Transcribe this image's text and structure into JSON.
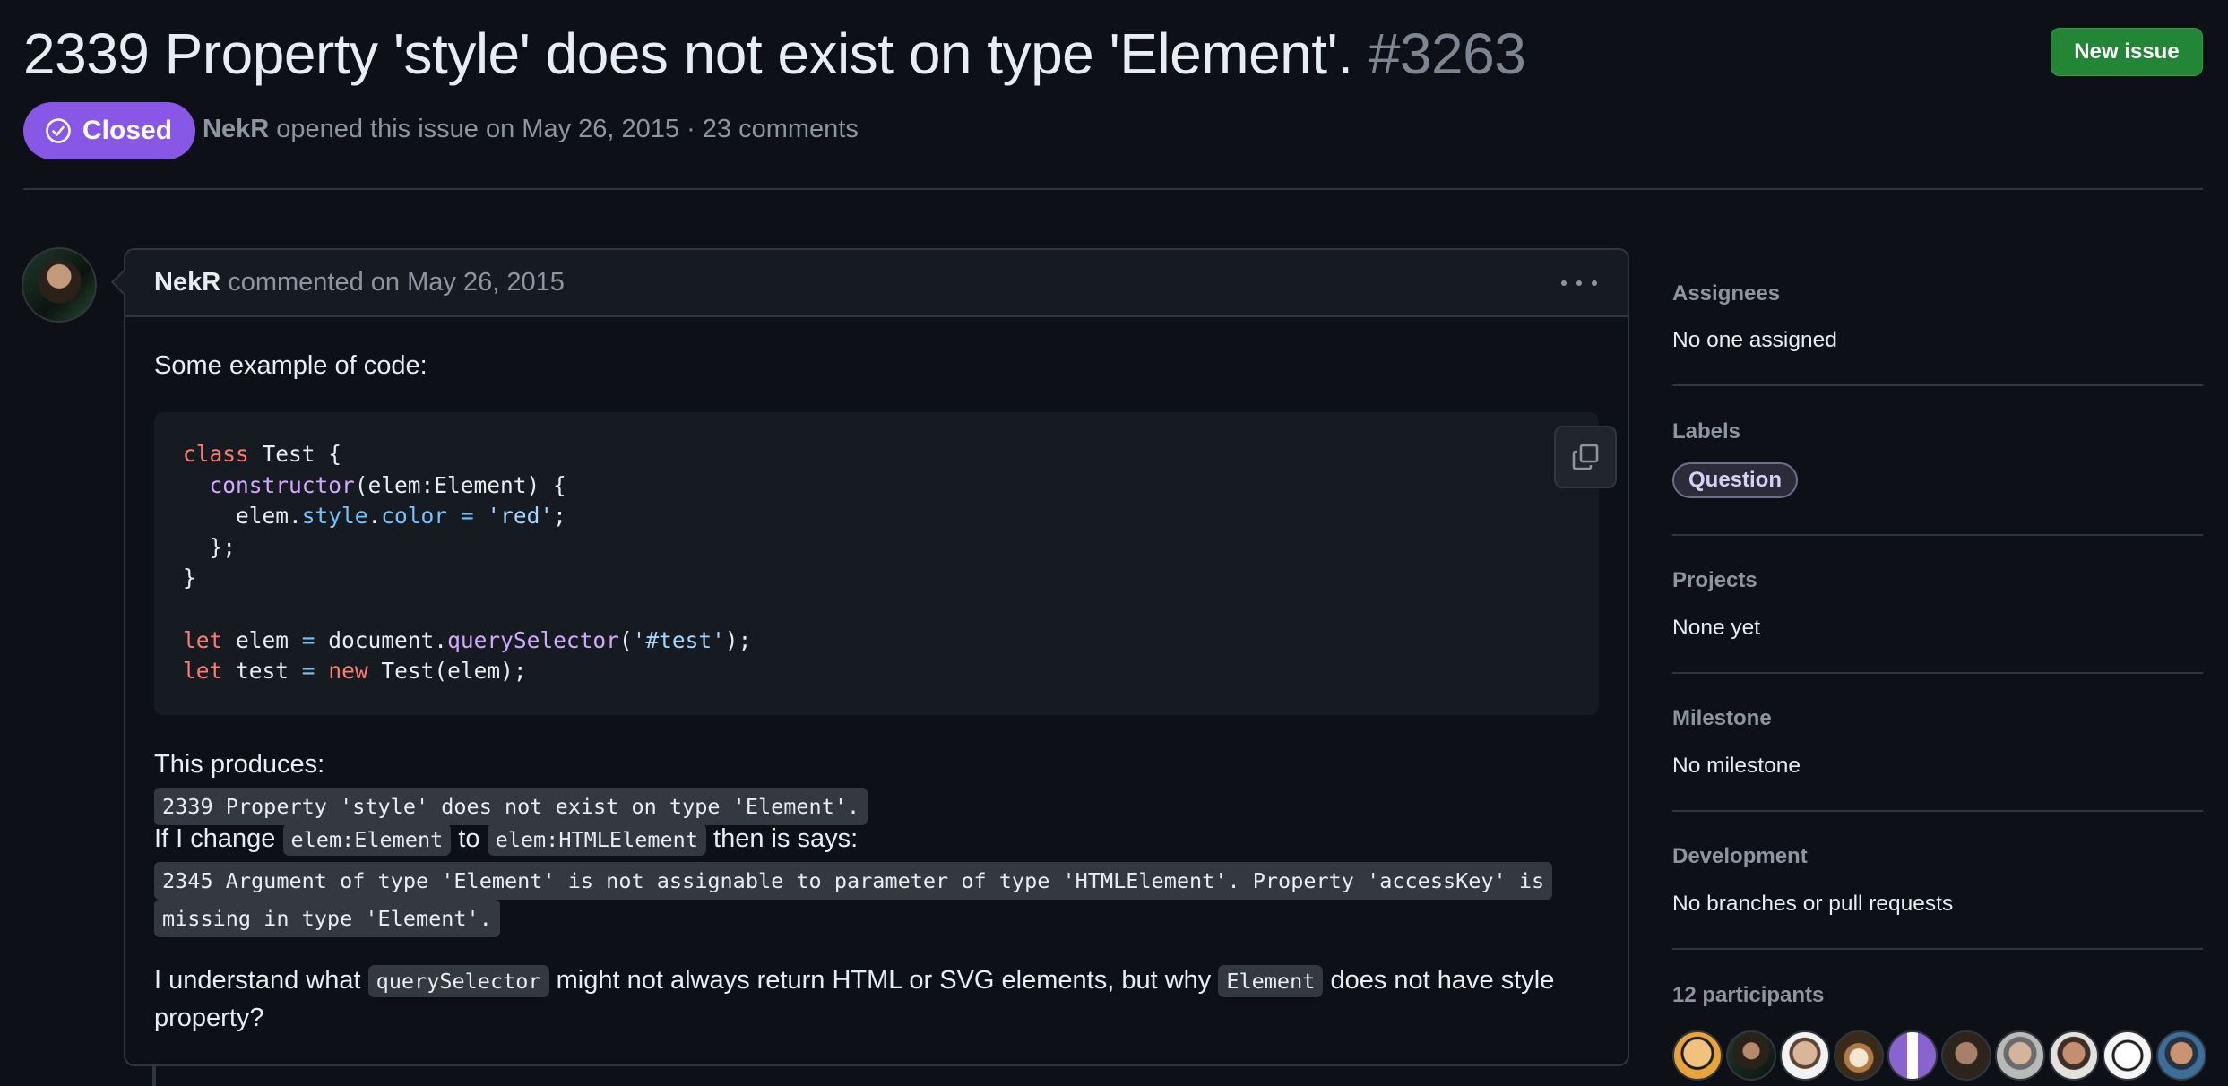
{
  "issue": {
    "title": "2339 Property 'style' does not exist on type 'Element'.",
    "number": "#3263",
    "state": "Closed",
    "author": "NekR",
    "opened_text": "opened this issue on May 26, 2015 · 23 comments"
  },
  "header": {
    "new_issue_label": "New issue"
  },
  "comment": {
    "author": "NekR",
    "meta": "commented on May 26, 2015",
    "intro": "Some example of code:",
    "produces_label": "This produces:",
    "error1": "2339 Property 'style' does not exist on type 'Element'.",
    "change_pre": "If I change",
    "change_from": "elem:Element",
    "change_to_word": "to",
    "change_to": "elem:HTMLElement",
    "change_post": "then is says:",
    "error2_line1": "2345 Argument of type 'Element' is not assignable to parameter of type 'HTMLElement'. Property 'accessKey' is",
    "error2_line2": "missing in type 'Element'.",
    "question_pre": "I understand what",
    "question_code1": "querySelector",
    "question_mid": "might not always return HTML or SVG elements, but why",
    "question_code2": "Element",
    "question_post": "does not have style",
    "question_line2": "property?"
  },
  "sidebar": {
    "assignees_heading": "Assignees",
    "assignees_value": "No one assigned",
    "labels_heading": "Labels",
    "label_question": "Question",
    "projects_heading": "Projects",
    "projects_value": "None yet",
    "milestone_heading": "Milestone",
    "milestone_value": "No milestone",
    "development_heading": "Development",
    "development_value": "No branches or pull requests",
    "participants_heading": "12 participants"
  },
  "colors": {
    "closed_badge": "#8957e5",
    "new_issue_button": "#238636",
    "background": "#0d1117"
  },
  "icons": [
    "check-circle-icon",
    "kebab-icon",
    "copy-icon"
  ]
}
